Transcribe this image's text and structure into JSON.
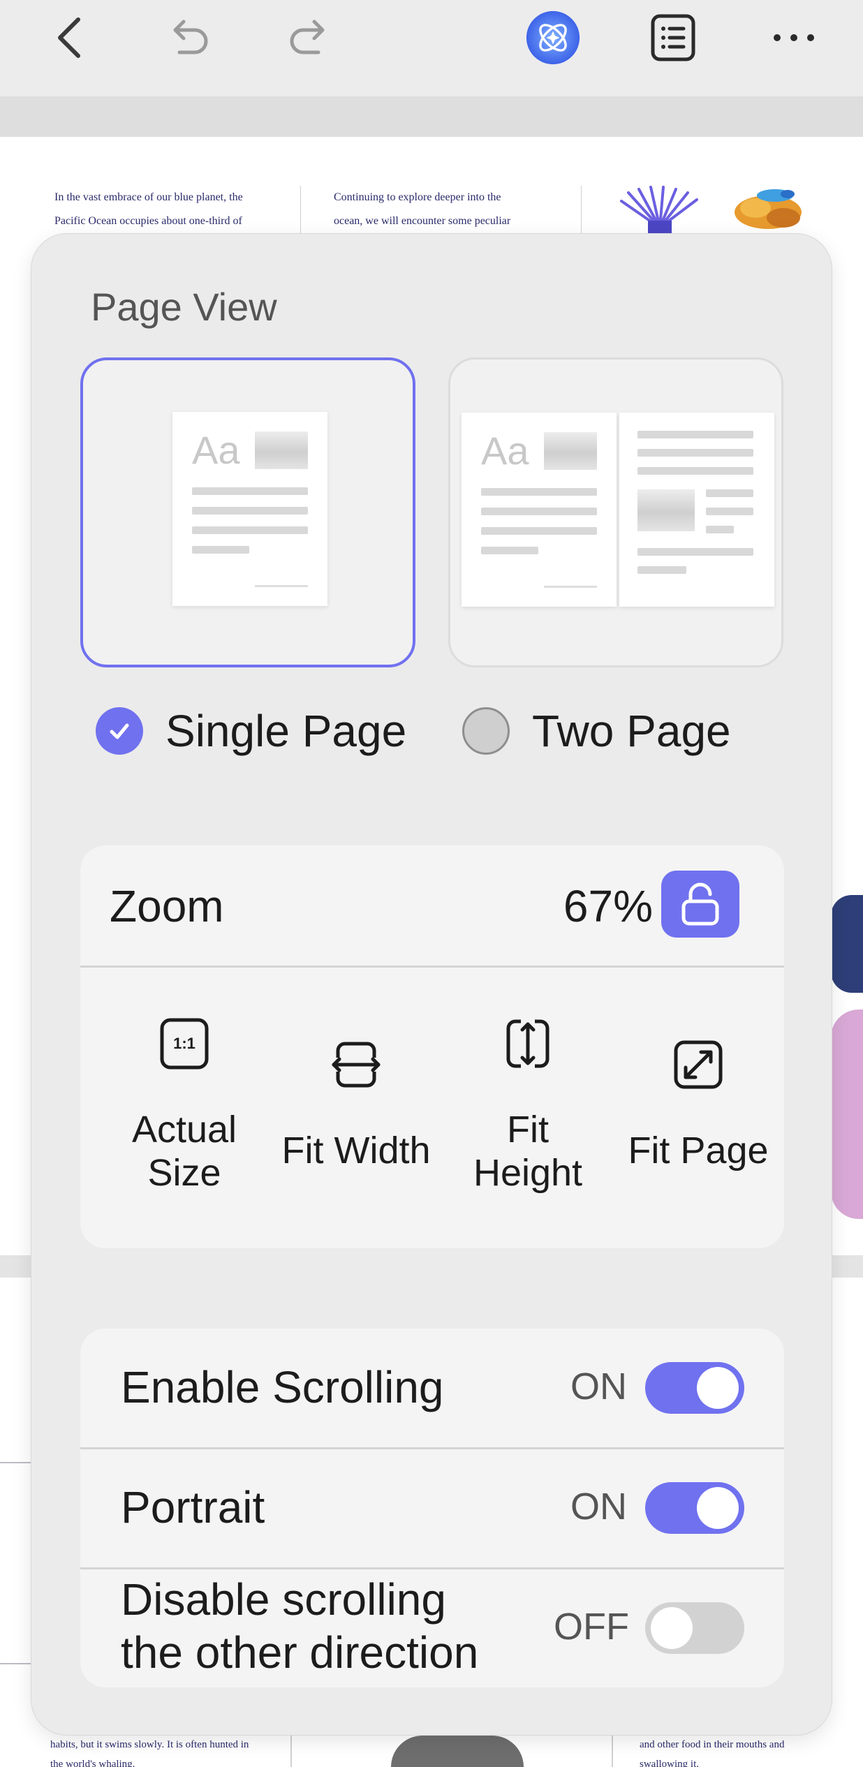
{
  "document": {
    "col1_lines": [
      "In the vast embrace of our blue planet, the",
      "Pacific Ocean occupies about one-third of"
    ],
    "col2_lines": [
      "Continuing to explore deeper into the",
      "ocean, we will encounter some peculiar"
    ],
    "bottom_left_lines": [
      "habits, but it swims slowly. It is often hunted in",
      "the world's whaling."
    ],
    "bottom_right_lines": [
      "and other food in their mouths and",
      "swallowing it."
    ]
  },
  "panel": {
    "title": "Page View",
    "thumb_text": "Aa",
    "single_page_label": "Single Page",
    "two_page_label": "Two Page",
    "zoom": {
      "label": "Zoom",
      "value": "67%",
      "options": [
        {
          "icon": "actual-size-icon",
          "label_lines": [
            "Actual",
            "Size"
          ]
        },
        {
          "icon": "fit-width-icon",
          "label_lines": [
            "Fit Width"
          ]
        },
        {
          "icon": "fit-height-icon",
          "label_lines": [
            "Fit",
            "Height"
          ]
        },
        {
          "icon": "fit-page-icon",
          "label_lines": [
            "Fit Page"
          ]
        }
      ],
      "actual_size_glyph": "1:1"
    },
    "toggles": [
      {
        "label_lines": [
          "Enable Scrolling"
        ],
        "state": "ON",
        "on": true
      },
      {
        "label_lines": [
          "Portrait"
        ],
        "state": "ON",
        "on": true
      },
      {
        "label_lines": [
          "Disable scrolling",
          "the other direction"
        ],
        "state": "OFF",
        "on": false
      }
    ]
  },
  "colors": {
    "accent": "#7071ef",
    "assistant_icon": "#4f7cf5"
  }
}
